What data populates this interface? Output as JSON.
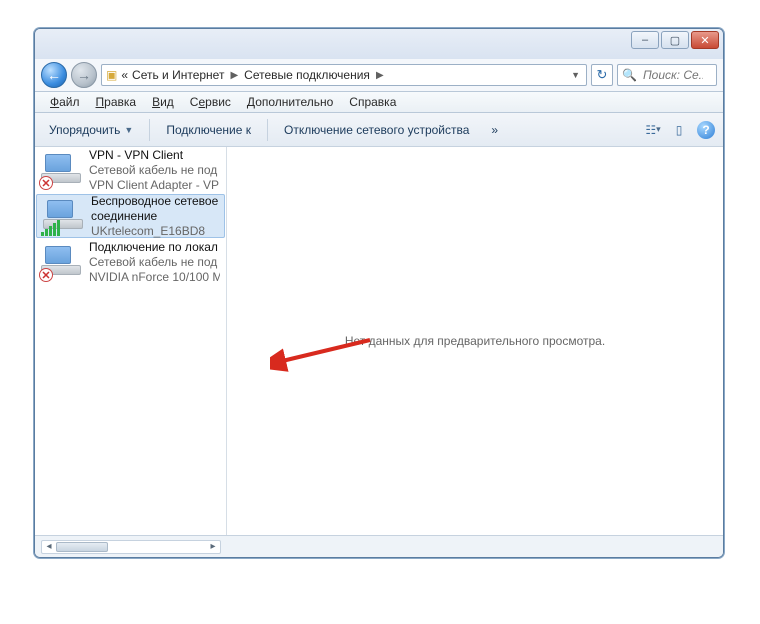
{
  "title_buttons": {
    "min": "–",
    "max": "▢",
    "close": "✕"
  },
  "breadcrumb": {
    "prefix": "«",
    "item1": "Сеть и Интернет",
    "item2": "Сетевые подключения"
  },
  "search": {
    "placeholder": "Поиск: Се..."
  },
  "menu": {
    "file": "Файл",
    "edit": "Правка",
    "view": "Вид",
    "tools": "Сервис",
    "advanced": "Дополнительно",
    "help": "Справка"
  },
  "toolbar": {
    "organize": "Упорядочить",
    "connect": "Подключение к",
    "disable": "Отключение сетевого устройства",
    "more": "»"
  },
  "connections": [
    {
      "title": "VPN - VPN Client",
      "sub1": "Сетевой кабель не под",
      "sub2": "VPN Client Adapter - VP",
      "status_icon": "x"
    },
    {
      "title": "Беспроводное сетевое",
      "sub1": "соединение",
      "sub2": "UKrtelecom_E16BD8",
      "status_icon": "bars"
    },
    {
      "title": "Подключение по локал",
      "sub1": "Сетевой кабель не под",
      "sub2": "NVIDIA nForce 10/100 M",
      "status_icon": "x"
    }
  ],
  "preview_empty": "Нет данных для предварительного просмотра.",
  "colors": {
    "accent": "#2d7ed6",
    "selection": "#d7e7f7",
    "arrow": "#d82a1e"
  }
}
